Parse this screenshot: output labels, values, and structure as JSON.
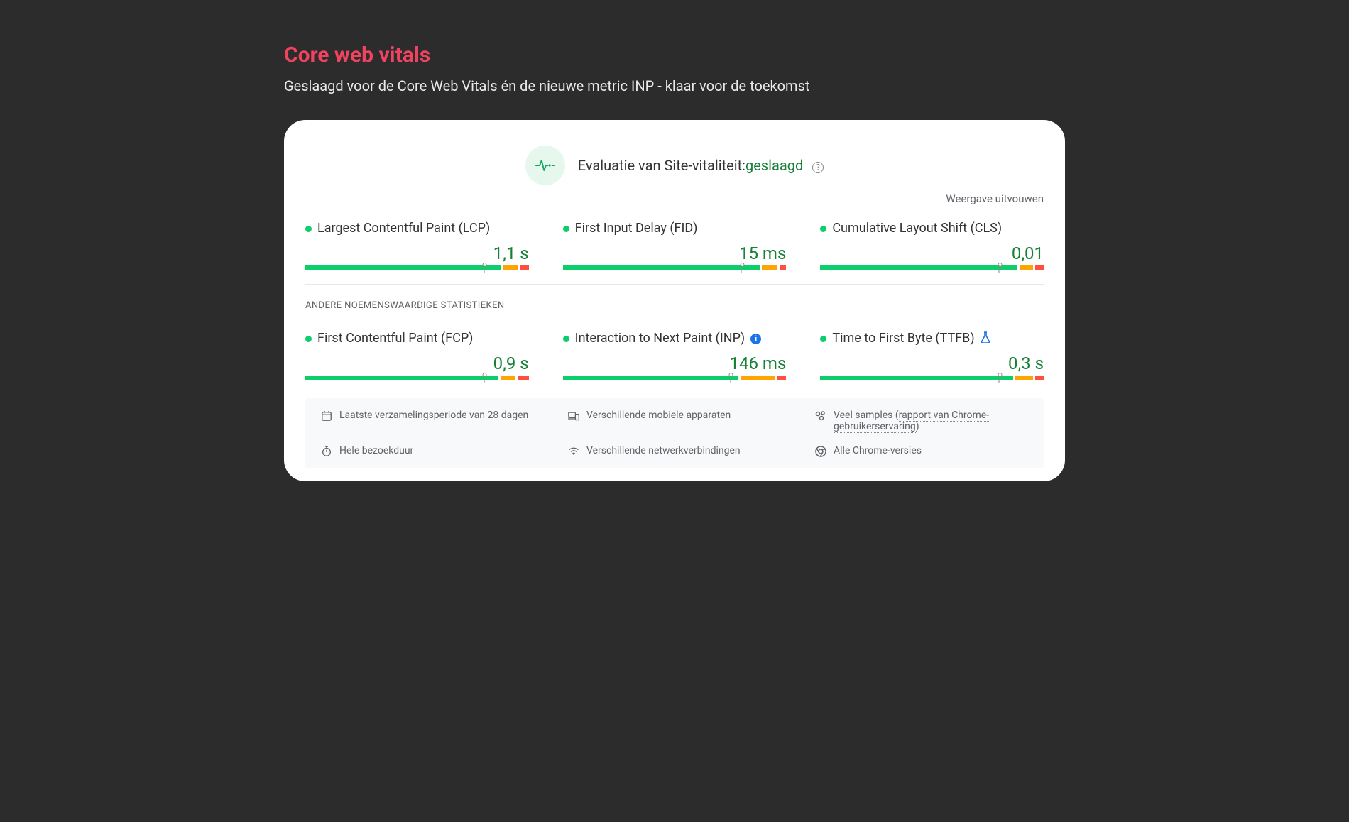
{
  "header": {
    "title": "Core web vitals",
    "subtitle": "Geslaagd voor de Core Web Vitals én de nieuwe metric INP - klaar voor de toekomst"
  },
  "status": {
    "label": "Evaluatie van Site-vitaliteit:",
    "result": "geslaagd"
  },
  "expand_label": "Weergave uitvouwen",
  "other_section_label": "ANDERE NOEMENSWAARDIGE STATISTIEKEN",
  "metrics": {
    "row1": [
      {
        "name": "Largest Contentful Paint (LCP)",
        "value": "1,1 s",
        "marker_percent": 80,
        "seg_green": 89,
        "seg_orange": 7,
        "seg_red": 4,
        "badge": ""
      },
      {
        "name": "First Input Delay (FID)",
        "value": "15 ms",
        "marker_percent": 80,
        "seg_green": 90,
        "seg_orange": 7,
        "seg_red": 3,
        "badge": ""
      },
      {
        "name": "Cumulative Layout Shift (CLS)",
        "value": "0,01",
        "marker_percent": 80,
        "seg_green": 90,
        "seg_orange": 6,
        "seg_red": 4,
        "badge": ""
      }
    ],
    "row2": [
      {
        "name": "First Contentful Paint (FCP)",
        "value": "0,9 s",
        "marker_percent": 80,
        "seg_green": 88,
        "seg_orange": 7,
        "seg_red": 5,
        "badge": ""
      },
      {
        "name": "Interaction to Next Paint (INP)",
        "value": "146 ms",
        "marker_percent": 75,
        "seg_green": 80,
        "seg_orange": 16,
        "seg_red": 4,
        "badge": "info"
      },
      {
        "name": "Time to First Byte (TTFB)",
        "value": "0,3 s",
        "marker_percent": 80,
        "seg_green": 88,
        "seg_orange": 8,
        "seg_red": 4,
        "badge": "lab"
      }
    ]
  },
  "footer": {
    "collection_period": "Laatste verzamelingsperiode van 28 dagen",
    "devices": "Verschillende mobiele apparaten",
    "samples_prefix": "Veel samples (",
    "samples_link": "rapport van Chrome-gebruikerservaring",
    "samples_suffix": ")",
    "session": "Hele bezoekduur",
    "networks": "Verschillende netwerkverbindingen",
    "versions": "Alle Chrome-versies"
  }
}
